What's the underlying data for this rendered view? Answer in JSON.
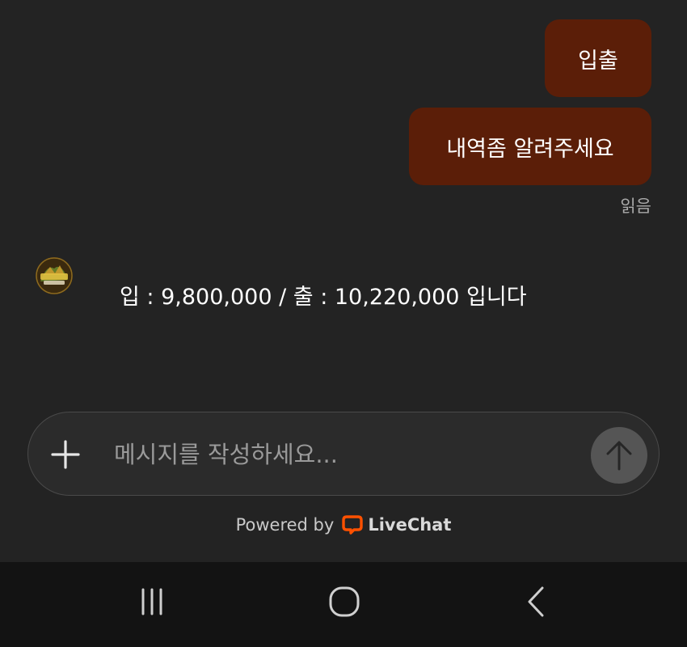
{
  "conversation": {
    "outgoing": [
      {
        "text": "입출"
      },
      {
        "text": "내역좀 알려주세요"
      }
    ],
    "read_receipt": "읽음",
    "incoming": [
      {
        "text": "입 : 9,800,000 / 출 : 10,220,000 입니다"
      }
    ]
  },
  "composer": {
    "placeholder": "메시지를 작성하세요...",
    "value": ""
  },
  "footer": {
    "powered_by": "Powered by",
    "brand": "LiveChat"
  },
  "colors": {
    "background": "#232323",
    "outgoing_bubble": "#5b1e08",
    "brand_orange": "#ff5100",
    "send_button": "#555555"
  },
  "icons": [
    "plus-icon",
    "send-arrow-icon",
    "livechat-logo-icon",
    "recents-icon",
    "home-icon",
    "back-icon"
  ]
}
